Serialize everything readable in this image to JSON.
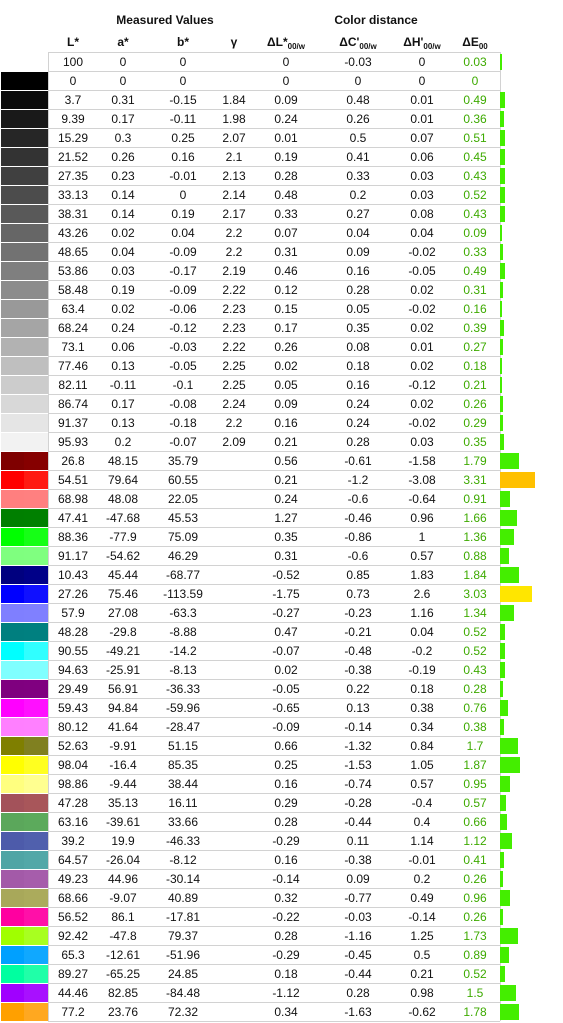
{
  "headers": {
    "measured_values": "Measured Values",
    "color_distance": "Color distance",
    "L": "L*",
    "a": "a*",
    "b": "b*",
    "gamma": "γ",
    "dL": "ΔL*",
    "dL_sub": "00/w",
    "dC": "ΔC'",
    "dC_sub": "00/w",
    "dH": "ΔH'",
    "dH_sub": "00/w",
    "dE": "ΔE",
    "dE_sub": "00"
  },
  "colors": {
    "delta_e_text": "#3daa00",
    "bar_ok": "#44ee00",
    "bar_warn": "#ffe600",
    "bar_bad": "#ffc000",
    "grid": "#d2d2d2"
  },
  "rows": [
    {
      "c1": "#ffffff",
      "c2": "#ffffff",
      "L": "100",
      "a": "0",
      "b": "0",
      "g": "",
      "dL": "0",
      "dC": "-0.03",
      "dH": "0",
      "dE": "0.03",
      "e": 0.03
    },
    {
      "c1": "#000000",
      "c2": "#000000",
      "L": "0",
      "a": "0",
      "b": "0",
      "g": "",
      "dL": "0",
      "dC": "0",
      "dH": "0",
      "dE": "0",
      "e": 0
    },
    {
      "c1": "#0b0b0b",
      "c2": "#0b0b0b",
      "L": "3.7",
      "a": "0.31",
      "b": "-0.15",
      "g": "1.84",
      "dL": "0.09",
      "dC": "0.48",
      "dH": "0.01",
      "dE": "0.49",
      "e": 0.49
    },
    {
      "c1": "#191919",
      "c2": "#191919",
      "L": "9.39",
      "a": "0.17",
      "b": "-0.11",
      "g": "1.98",
      "dL": "0.24",
      "dC": "0.26",
      "dH": "0.01",
      "dE": "0.36",
      "e": 0.36
    },
    {
      "c1": "#262626",
      "c2": "#262626",
      "L": "15.29",
      "a": "0.3",
      "b": "0.25",
      "g": "2.07",
      "dL": "0.01",
      "dC": "0.5",
      "dH": "0.07",
      "dE": "0.51",
      "e": 0.51
    },
    {
      "c1": "#333333",
      "c2": "#333333",
      "L": "21.52",
      "a": "0.26",
      "b": "0.16",
      "g": "2.1",
      "dL": "0.19",
      "dC": "0.41",
      "dH": "0.06",
      "dE": "0.45",
      "e": 0.45
    },
    {
      "c1": "#404040",
      "c2": "#404040",
      "L": "27.35",
      "a": "0.23",
      "b": "-0.01",
      "g": "2.13",
      "dL": "0.28",
      "dC": "0.33",
      "dH": "0.03",
      "dE": "0.43",
      "e": 0.43
    },
    {
      "c1": "#4c4c4c",
      "c2": "#4c4c4c",
      "L": "33.13",
      "a": "0.14",
      "b": "0",
      "g": "2.14",
      "dL": "0.48",
      "dC": "0.2",
      "dH": "0.03",
      "dE": "0.52",
      "e": 0.52
    },
    {
      "c1": "#595959",
      "c2": "#595959",
      "L": "38.31",
      "a": "0.14",
      "b": "0.19",
      "g": "2.17",
      "dL": "0.33",
      "dC": "0.27",
      "dH": "0.08",
      "dE": "0.43",
      "e": 0.43
    },
    {
      "c1": "#666666",
      "c2": "#666666",
      "L": "43.26",
      "a": "0.02",
      "b": "0.04",
      "g": "2.2",
      "dL": "0.07",
      "dC": "0.04",
      "dH": "0.04",
      "dE": "0.09",
      "e": 0.09
    },
    {
      "c1": "#727272",
      "c2": "#727272",
      "L": "48.65",
      "a": "0.04",
      "b": "-0.09",
      "g": "2.2",
      "dL": "0.31",
      "dC": "0.09",
      "dH": "-0.02",
      "dE": "0.33",
      "e": 0.33
    },
    {
      "c1": "#7f7f7f",
      "c2": "#7f7f7f",
      "L": "53.86",
      "a": "0.03",
      "b": "-0.17",
      "g": "2.19",
      "dL": "0.46",
      "dC": "0.16",
      "dH": "-0.05",
      "dE": "0.49",
      "e": 0.49
    },
    {
      "c1": "#8c8c8c",
      "c2": "#8c8c8c",
      "L": "58.48",
      "a": "0.19",
      "b": "-0.09",
      "g": "2.22",
      "dL": "0.12",
      "dC": "0.28",
      "dH": "0.02",
      "dE": "0.31",
      "e": 0.31
    },
    {
      "c1": "#999999",
      "c2": "#999999",
      "L": "63.4",
      "a": "0.02",
      "b": "-0.06",
      "g": "2.23",
      "dL": "0.15",
      "dC": "0.05",
      "dH": "-0.02",
      "dE": "0.16",
      "e": 0.16
    },
    {
      "c1": "#a5a5a5",
      "c2": "#a5a5a5",
      "L": "68.24",
      "a": "0.24",
      "b": "-0.12",
      "g": "2.23",
      "dL": "0.17",
      "dC": "0.35",
      "dH": "0.02",
      "dE": "0.39",
      "e": 0.39
    },
    {
      "c1": "#b2b2b2",
      "c2": "#b2b2b2",
      "L": "73.1",
      "a": "0.06",
      "b": "-0.03",
      "g": "2.22",
      "dL": "0.26",
      "dC": "0.08",
      "dH": "0.01",
      "dE": "0.27",
      "e": 0.27
    },
    {
      "c1": "#bfbfbf",
      "c2": "#bfbfbf",
      "L": "77.46",
      "a": "0.13",
      "b": "-0.05",
      "g": "2.25",
      "dL": "0.02",
      "dC": "0.18",
      "dH": "0.02",
      "dE": "0.18",
      "e": 0.18
    },
    {
      "c1": "#cccccc",
      "c2": "#cccccc",
      "L": "82.11",
      "a": "-0.11",
      "b": "-0.1",
      "g": "2.25",
      "dL": "0.05",
      "dC": "0.16",
      "dH": "-0.12",
      "dE": "0.21",
      "e": 0.21
    },
    {
      "c1": "#d8d8d8",
      "c2": "#d8d8d8",
      "L": "86.74",
      "a": "0.17",
      "b": "-0.08",
      "g": "2.24",
      "dL": "0.09",
      "dC": "0.24",
      "dH": "0.02",
      "dE": "0.26",
      "e": 0.26
    },
    {
      "c1": "#e5e5e5",
      "c2": "#e5e5e5",
      "L": "91.37",
      "a": "0.13",
      "b": "-0.18",
      "g": "2.2",
      "dL": "0.16",
      "dC": "0.24",
      "dH": "-0.02",
      "dE": "0.29",
      "e": 0.29
    },
    {
      "c1": "#f2f2f2",
      "c2": "#f2f2f2",
      "L": "95.93",
      "a": "0.2",
      "b": "-0.07",
      "g": "2.09",
      "dL": "0.21",
      "dC": "0.28",
      "dH": "0.03",
      "dE": "0.35",
      "e": 0.35
    },
    {
      "c1": "#7f0000",
      "c2": "#860000",
      "L": "26.8",
      "a": "48.15",
      "b": "35.79",
      "g": "",
      "dL": "0.56",
      "dC": "-0.61",
      "dH": "-1.58",
      "dE": "1.79",
      "e": 1.79
    },
    {
      "c1": "#ff0000",
      "c2": "#ff1a12",
      "L": "54.51",
      "a": "79.64",
      "b": "60.55",
      "g": "",
      "dL": "0.21",
      "dC": "-1.2",
      "dH": "-3.08",
      "dE": "3.31",
      "e": 3.31
    },
    {
      "c1": "#ff7f7f",
      "c2": "#ff8080",
      "L": "68.98",
      "a": "48.08",
      "b": "22.05",
      "g": "",
      "dL": "0.24",
      "dC": "-0.6",
      "dH": "-0.64",
      "dE": "0.91",
      "e": 0.91
    },
    {
      "c1": "#007f00",
      "c2": "#008000",
      "L": "47.41",
      "a": "-47.68",
      "b": "45.53",
      "g": "",
      "dL": "1.27",
      "dC": "-0.46",
      "dH": "0.96",
      "dE": "1.66",
      "e": 1.66
    },
    {
      "c1": "#00ff00",
      "c2": "#16ff16",
      "L": "88.36",
      "a": "-77.9",
      "b": "75.09",
      "g": "",
      "dL": "0.35",
      "dC": "-0.86",
      "dH": "1",
      "dE": "1.36",
      "e": 1.36
    },
    {
      "c1": "#7fff7f",
      "c2": "#80ff80",
      "L": "91.17",
      "a": "-54.62",
      "b": "46.29",
      "g": "",
      "dL": "0.31",
      "dC": "-0.6",
      "dH": "0.57",
      "dE": "0.88",
      "e": 0.88
    },
    {
      "c1": "#00007f",
      "c2": "#000088",
      "L": "10.43",
      "a": "45.44",
      "b": "-68.77",
      "g": "",
      "dL": "-0.52",
      "dC": "0.85",
      "dH": "1.83",
      "dE": "1.84",
      "e": 1.84
    },
    {
      "c1": "#0000ff",
      "c2": "#1010ff",
      "L": "27.26",
      "a": "75.46",
      "b": "-113.59",
      "g": "",
      "dL": "-1.75",
      "dC": "0.73",
      "dH": "2.6",
      "dE": "3.03",
      "e": 3.03
    },
    {
      "c1": "#7f7fff",
      "c2": "#8080ff",
      "L": "57.9",
      "a": "27.08",
      "b": "-63.3",
      "g": "",
      "dL": "-0.27",
      "dC": "-0.23",
      "dH": "1.16",
      "dE": "1.34",
      "e": 1.34
    },
    {
      "c1": "#007f7f",
      "c2": "#008080",
      "L": "48.28",
      "a": "-29.8",
      "b": "-8.88",
      "g": "",
      "dL": "0.47",
      "dC": "-0.21",
      "dH": "0.04",
      "dE": "0.52",
      "e": 0.52
    },
    {
      "c1": "#00ffff",
      "c2": "#30ffff",
      "L": "90.55",
      "a": "-49.21",
      "b": "-14.2",
      "g": "",
      "dL": "-0.07",
      "dC": "-0.48",
      "dH": "-0.2",
      "dE": "0.52",
      "e": 0.52
    },
    {
      "c1": "#7fffff",
      "c2": "#80ffff",
      "L": "94.63",
      "a": "-25.91",
      "b": "-8.13",
      "g": "",
      "dL": "0.02",
      "dC": "-0.38",
      "dH": "-0.19",
      "dE": "0.43",
      "e": 0.43
    },
    {
      "c1": "#7f007f",
      "c2": "#800080",
      "L": "29.49",
      "a": "56.91",
      "b": "-36.33",
      "g": "",
      "dL": "-0.05",
      "dC": "0.22",
      "dH": "0.18",
      "dE": "0.28",
      "e": 0.28
    },
    {
      "c1": "#ff00ff",
      "c2": "#ff10ff",
      "L": "59.43",
      "a": "94.84",
      "b": "-59.96",
      "g": "",
      "dL": "-0.65",
      "dC": "0.13",
      "dH": "0.38",
      "dE": "0.76",
      "e": 0.76
    },
    {
      "c1": "#ff7fff",
      "c2": "#ff80ff",
      "L": "80.12",
      "a": "41.64",
      "b": "-28.47",
      "g": "",
      "dL": "-0.09",
      "dC": "-0.14",
      "dH": "0.34",
      "dE": "0.38",
      "e": 0.38
    },
    {
      "c1": "#7f7f00",
      "c2": "#808020",
      "L": "52.63",
      "a": "-9.91",
      "b": "51.15",
      "g": "",
      "dL": "0.66",
      "dC": "-1.32",
      "dH": "0.84",
      "dE": "1.7",
      "e": 1.7
    },
    {
      "c1": "#ffff00",
      "c2": "#ffff20",
      "L": "98.04",
      "a": "-16.4",
      "b": "85.35",
      "g": "",
      "dL": "0.25",
      "dC": "-1.53",
      "dH": "1.05",
      "dE": "1.87",
      "e": 1.87
    },
    {
      "c1": "#ffff7f",
      "c2": "#ffff90",
      "L": "98.86",
      "a": "-9.44",
      "b": "38.44",
      "g": "",
      "dL": "0.16",
      "dC": "-0.74",
      "dH": "0.57",
      "dE": "0.95",
      "e": 0.95
    },
    {
      "c1": "#a3525a",
      "c2": "#a8565a",
      "L": "47.28",
      "a": "35.13",
      "b": "16.11",
      "g": "",
      "dL": "0.29",
      "dC": "-0.28",
      "dH": "-0.4",
      "dE": "0.57",
      "e": 0.57
    },
    {
      "c1": "#5ba75b",
      "c2": "#5caa5c",
      "L": "63.16",
      "a": "-39.61",
      "b": "33.66",
      "g": "",
      "dL": "0.28",
      "dC": "-0.44",
      "dH": "0.4",
      "dE": "0.66",
      "e": 0.66
    },
    {
      "c1": "#4d5baa",
      "c2": "#5060ad",
      "L": "39.2",
      "a": "19.9",
      "b": "-46.33",
      "g": "",
      "dL": "-0.29",
      "dC": "0.11",
      "dH": "1.14",
      "dE": "1.12",
      "e": 1.12
    },
    {
      "c1": "#50a5a5",
      "c2": "#53a8a8",
      "L": "64.57",
      "a": "-26.04",
      "b": "-8.12",
      "g": "",
      "dL": "0.16",
      "dC": "-0.38",
      "dH": "-0.01",
      "dE": "0.41",
      "e": 0.41
    },
    {
      "c1": "#a35aa8",
      "c2": "#a65dab",
      "L": "49.23",
      "a": "44.96",
      "b": "-30.14",
      "g": "",
      "dL": "-0.14",
      "dC": "0.09",
      "dH": "0.2",
      "dE": "0.26",
      "e": 0.26
    },
    {
      "c1": "#a8a85a",
      "c2": "#abab5c",
      "L": "68.66",
      "a": "-9.07",
      "b": "40.89",
      "g": "",
      "dL": "0.32",
      "dC": "-0.77",
      "dH": "0.49",
      "dE": "0.96",
      "e": 0.96
    },
    {
      "c1": "#ff00a0",
      "c2": "#ff10a8",
      "L": "56.52",
      "a": "86.1",
      "b": "-17.81",
      "g": "",
      "dL": "-0.22",
      "dC": "-0.03",
      "dH": "-0.14",
      "dE": "0.26",
      "e": 0.26
    },
    {
      "c1": "#a0ff00",
      "c2": "#a8ff20",
      "L": "92.42",
      "a": "-47.8",
      "b": "79.37",
      "g": "",
      "dL": "0.28",
      "dC": "-1.16",
      "dH": "1.25",
      "dE": "1.73",
      "e": 1.73
    },
    {
      "c1": "#00a0ff",
      "c2": "#10a8ff",
      "L": "65.3",
      "a": "-12.61",
      "b": "-51.96",
      "g": "",
      "dL": "-0.29",
      "dC": "-0.45",
      "dH": "0.5",
      "dE": "0.89",
      "e": 0.89
    },
    {
      "c1": "#00ffa0",
      "c2": "#20ffa8",
      "L": "89.27",
      "a": "-65.25",
      "b": "24.85",
      "g": "",
      "dL": "0.18",
      "dC": "-0.44",
      "dH": "0.21",
      "dE": "0.52",
      "e": 0.52
    },
    {
      "c1": "#a000ff",
      "c2": "#a810ff",
      "L": "44.46",
      "a": "82.85",
      "b": "-84.48",
      "g": "",
      "dL": "-1.12",
      "dC": "0.28",
      "dH": "0.98",
      "dE": "1.5",
      "e": 1.5
    },
    {
      "c1": "#ffa000",
      "c2": "#ffa820",
      "L": "77.2",
      "a": "23.76",
      "b": "72.32",
      "g": "",
      "dL": "0.34",
      "dC": "-1.63",
      "dH": "-0.62",
      "dE": "1.78",
      "e": 1.78
    }
  ]
}
